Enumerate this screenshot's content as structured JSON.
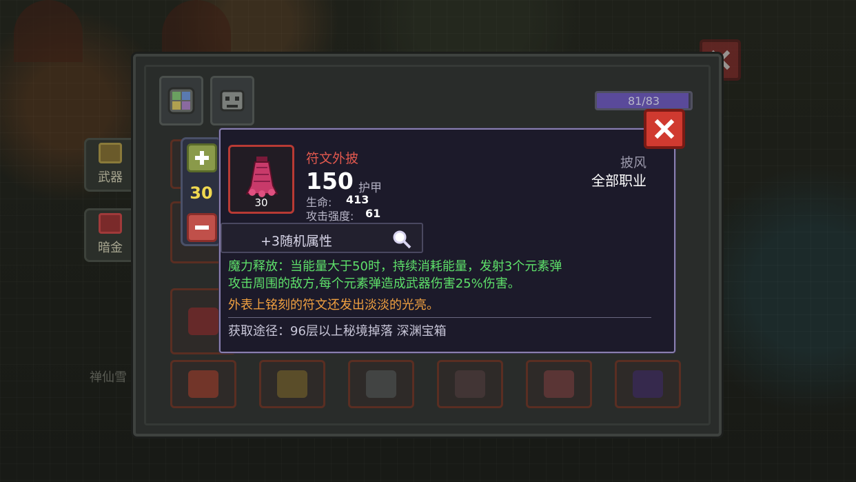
{
  "side_nav": {
    "weapon_label": "武器",
    "gold_label": "暗金",
    "character_name": "禅仙雪"
  },
  "inventory": {
    "capacity_used": 81,
    "capacity_total": 83,
    "capacity_text": "81/83",
    "tabs": [
      "bag-icon",
      "pet-icon"
    ]
  },
  "stepper": {
    "quantity": "30"
  },
  "item": {
    "name": "符文外披",
    "level": "30",
    "armor_value": "150",
    "armor_label": "护甲",
    "stats": [
      {
        "label": "生命:",
        "value": "413"
      },
      {
        "label": "攻击强度:",
        "value": "61"
      }
    ],
    "type": "披风",
    "class_req": "全部职业",
    "random_attr": "+3随机属性",
    "effect_line1": "魔力释放：当能量大于50时，持续消耗能量，发射3个元素弹",
    "effect_line2": "攻击周围的敌方,每个元素弹造成武器伤害25%伤害。",
    "flavor": "外表上铭刻的符文还发出淡淡的光亮。",
    "source": "获取途径：96层以上秘境掉落 深渊宝箱"
  },
  "colors": {
    "item_name": "#e0584e",
    "effect_text": "#5ee06a",
    "flavor_text": "#f0a040",
    "close_button": "#d03a30",
    "quantity": "#f0d850"
  }
}
